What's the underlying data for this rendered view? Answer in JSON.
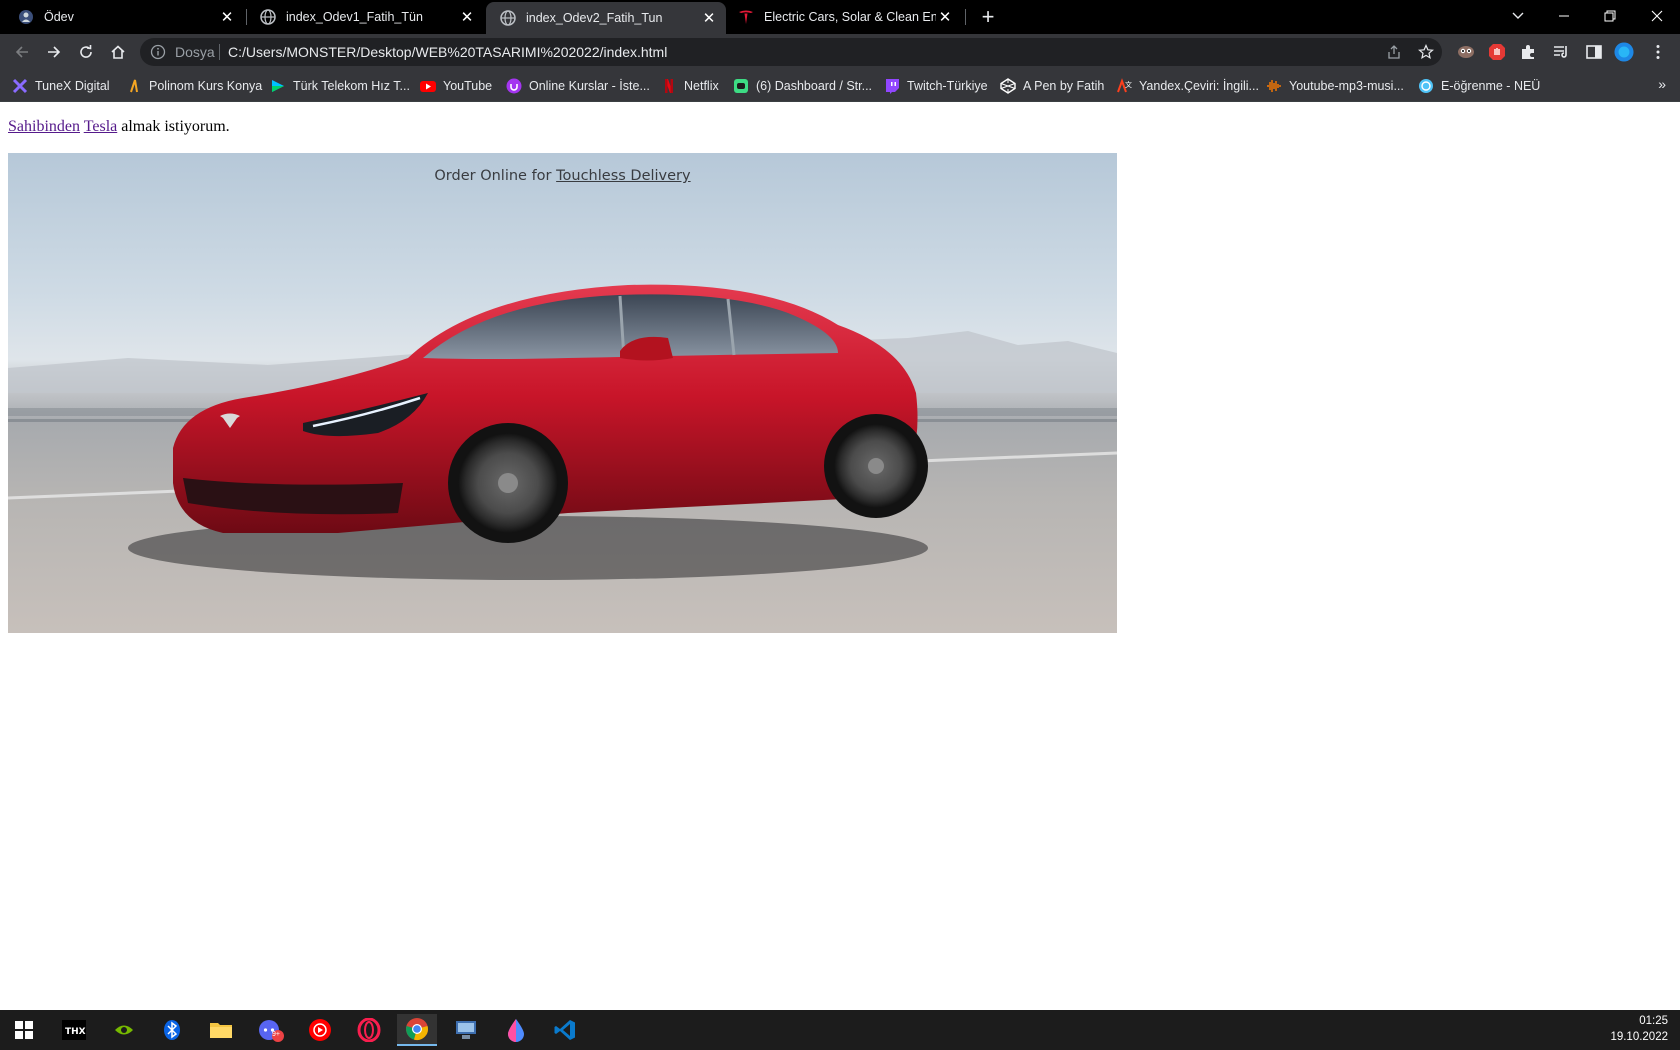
{
  "tabs": [
    {
      "title": "Ödev",
      "icon": "odev-favicon",
      "active": false
    },
    {
      "title": "index_Odev1_Fatih_Tün",
      "icon": "globe-icon",
      "active": false
    },
    {
      "title": "index_Odev2_Fatih_Tun",
      "icon": "globe-icon",
      "active": true
    },
    {
      "title": "Electric Cars, Solar & Clean Energy | Tesla",
      "icon": "tesla-icon",
      "active": false
    }
  ],
  "window_controls": {
    "minimize": "–",
    "restore": "❐",
    "close": "✕",
    "tab_search": "⌄",
    "new_tab": "+"
  },
  "toolbar": {
    "protocol_label": "Dosya",
    "url": "C:/Users/MONSTER/Desktop/WEB%20TASARIMI%202022/index.html"
  },
  "bookmarks": [
    {
      "label": "TuneX Digital",
      "icon": "tunex-icon",
      "color": "#7b5cff"
    },
    {
      "label": "Polinom Kurs Konya",
      "icon": "polinom-icon",
      "color": "#f5a623"
    },
    {
      "label": "Türk Telekom Hız T...",
      "icon": "play-icon",
      "color": "#00c2ff"
    },
    {
      "label": "YouTube",
      "icon": "youtube-icon",
      "color": "#ff0000"
    },
    {
      "label": "Online Kurslar - İste...",
      "icon": "udemy-icon",
      "color": "#a435f0"
    },
    {
      "label": "Netflix",
      "icon": "netflix-icon",
      "color": "#e50914"
    },
    {
      "label": "(6) Dashboard / Str...",
      "icon": "discord-icon",
      "color": "#3ddc84"
    },
    {
      "label": "Twitch-Türkiye",
      "icon": "twitch-icon",
      "color": "#9146ff"
    },
    {
      "label": "A Pen by Fatih",
      "icon": "codepen-icon",
      "color": "#ffffff"
    },
    {
      "label": "Yandex.Çeviri: İngili...",
      "icon": "yandex-translate-icon",
      "color": "#fc3f1d"
    },
    {
      "label": "Youtube-mp3-musi...",
      "icon": "mp3-icon",
      "color": "#ff7a00"
    },
    {
      "label": "E-öğrenme - NEÜ",
      "icon": "neu-icon",
      "color": "#4fc3f7"
    }
  ],
  "bookmarks_more": "»",
  "page": {
    "link1": "Sahibinden",
    "link2": "Tesla",
    "rest": " almak istiyorum."
  },
  "hero": {
    "text_prefix": "Order Online for ",
    "text_link": "Touchless Delivery",
    "image_alt": "Red Tesla Model S driving on a highway"
  },
  "taskbar": {
    "time": "01:25",
    "date": "19.10.2022",
    "discord_badge": "9+"
  }
}
